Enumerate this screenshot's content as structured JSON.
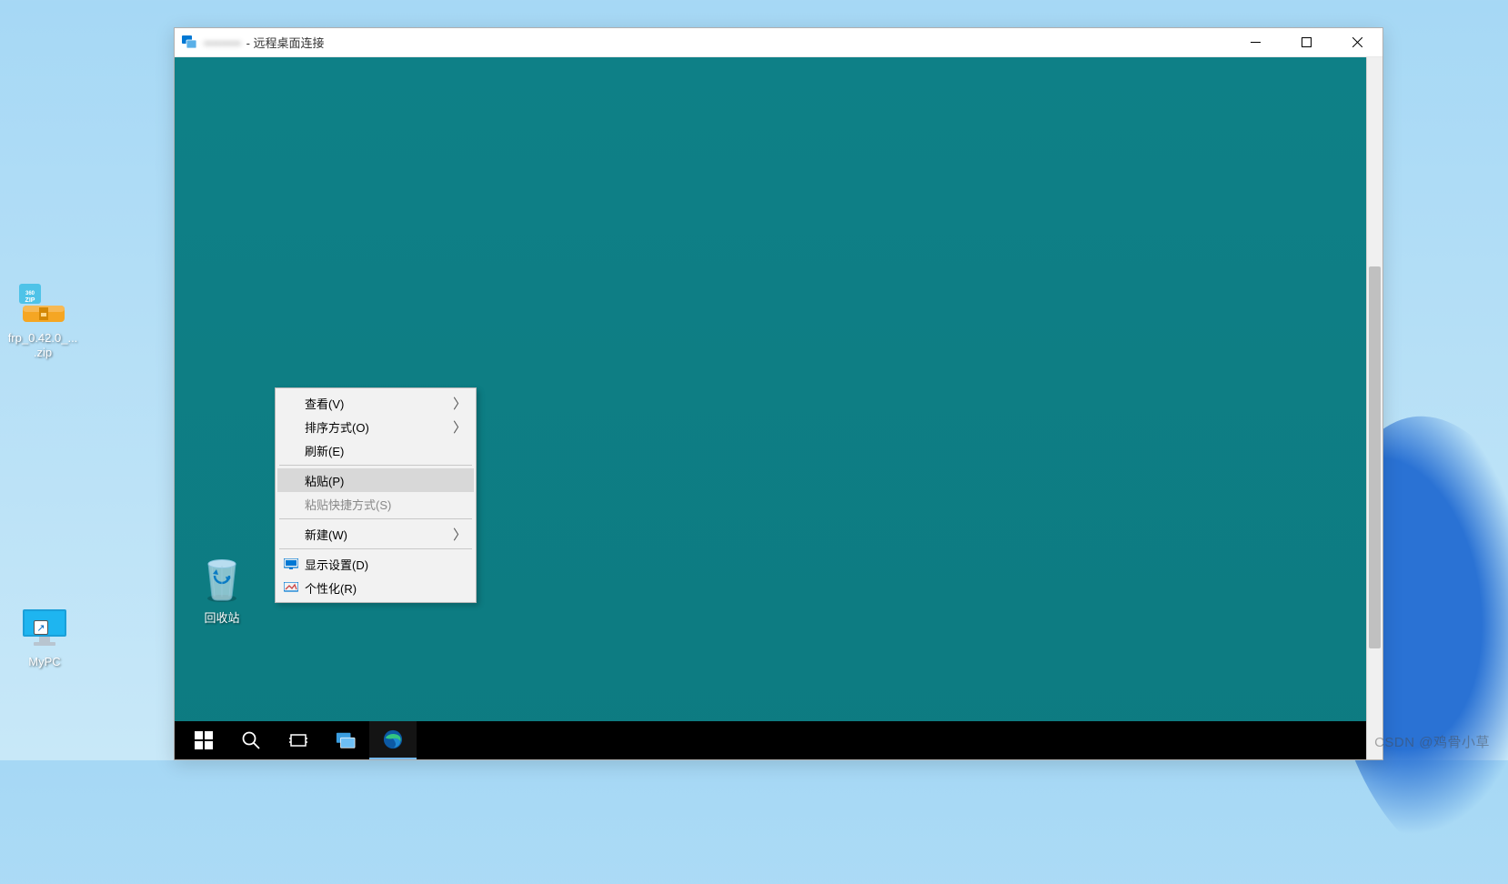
{
  "host_desktop": {
    "zip_file_label": "frp_0.42.0_...\n.zip",
    "mypc_label": "MyPC"
  },
  "rdp_window": {
    "title_host": "•••••••••",
    "title_suffix": " - 远程桌面连接"
  },
  "remote_desktop": {
    "recycle_bin_label": "回收站"
  },
  "context_menu": {
    "view": "查看(V)",
    "sort": "排序方式(O)",
    "refresh": "刷新(E)",
    "paste": "粘贴(P)",
    "paste_shortcut": "粘贴快捷方式(S)",
    "new": "新建(W)",
    "display_settings": "显示设置(D)",
    "personalize": "个性化(R)"
  },
  "watermark": "CSDN @鸡骨小草"
}
